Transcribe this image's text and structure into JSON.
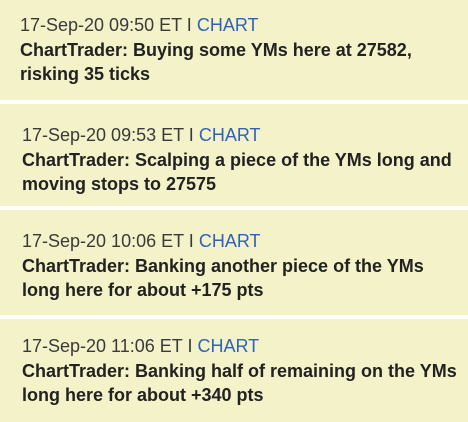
{
  "entries": [
    {
      "timestamp": "17-Sep-20 09:50 ET",
      "separator": "I",
      "link_label": "CHART",
      "message": "ChartTrader: Buying some YMs here at 27582, risking 35 ticks"
    },
    {
      "timestamp": "17-Sep-20 09:53 ET",
      "separator": "I",
      "link_label": "CHART",
      "message": "ChartTrader: Scalping a piece of the YMs long and moving stops to 27575"
    },
    {
      "timestamp": "17-Sep-20 10:06 ET",
      "separator": "I",
      "link_label": "CHART",
      "message": "ChartTrader: Banking another piece of the YMs long here for about +175 pts"
    },
    {
      "timestamp": "17-Sep-20 11:06 ET",
      "separator": "I",
      "link_label": "CHART",
      "message": "ChartTrader: Banking half of remaining on the YMs long here for about +340 pts"
    }
  ],
  "colors": {
    "entry_background": "#f3f2c9",
    "link": "#2f62b8",
    "text": "#222222"
  }
}
